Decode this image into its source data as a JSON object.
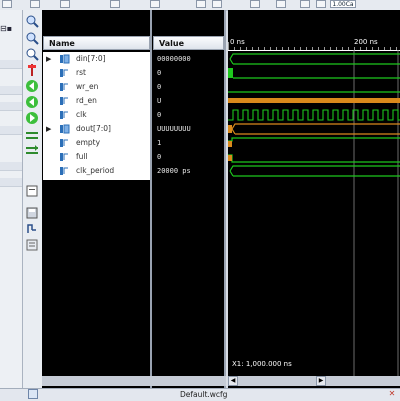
{
  "toolbar": {
    "zoom_value": "1.00Ca"
  },
  "left_panel": {
    "restore_label": "⊟▪"
  },
  "name_column": {
    "header": "Name"
  },
  "value_column": {
    "header": "Value"
  },
  "signals": [
    {
      "name": "din[7:0]",
      "value": "00000000",
      "kind": "bus",
      "expandable": true
    },
    {
      "name": "rst",
      "value": "0",
      "kind": "bit",
      "expandable": false
    },
    {
      "name": "wr_en",
      "value": "0",
      "kind": "bit",
      "expandable": false
    },
    {
      "name": "rd_en",
      "value": "U",
      "kind": "bit",
      "expandable": false
    },
    {
      "name": "clk",
      "value": "0",
      "kind": "bit",
      "expandable": false
    },
    {
      "name": "dout[7:0]",
      "value": "UUUUUUUU",
      "kind": "bus",
      "expandable": true
    },
    {
      "name": "empty",
      "value": "1",
      "kind": "bit",
      "expandable": false
    },
    {
      "name": "full",
      "value": "0",
      "kind": "bit",
      "expandable": false
    },
    {
      "name": "clk_period",
      "value": "20000 ps",
      "kind": "param",
      "expandable": false
    }
  ],
  "timeline": {
    "ticks": [
      "0 ns",
      "200 ns"
    ]
  },
  "cursor": {
    "label": "X1: 1,000.000 ns"
  },
  "bottom_tab": {
    "label": "Default.wcfg"
  },
  "colors": {
    "wave_green": "#1ec81e",
    "wave_orange": "#d98a1c",
    "background": "#000000",
    "cursor_white": "#ffffff"
  },
  "icons": [
    "restore-icon",
    "zoom-in-icon",
    "zoom-out-icon",
    "zoom-fit-icon",
    "marker-icon",
    "go-first-icon",
    "go-prev-icon",
    "go-next-icon",
    "swap-icon",
    "group-icon",
    "divider-icon",
    "save-icon",
    "snap-icon",
    "list-icon"
  ]
}
